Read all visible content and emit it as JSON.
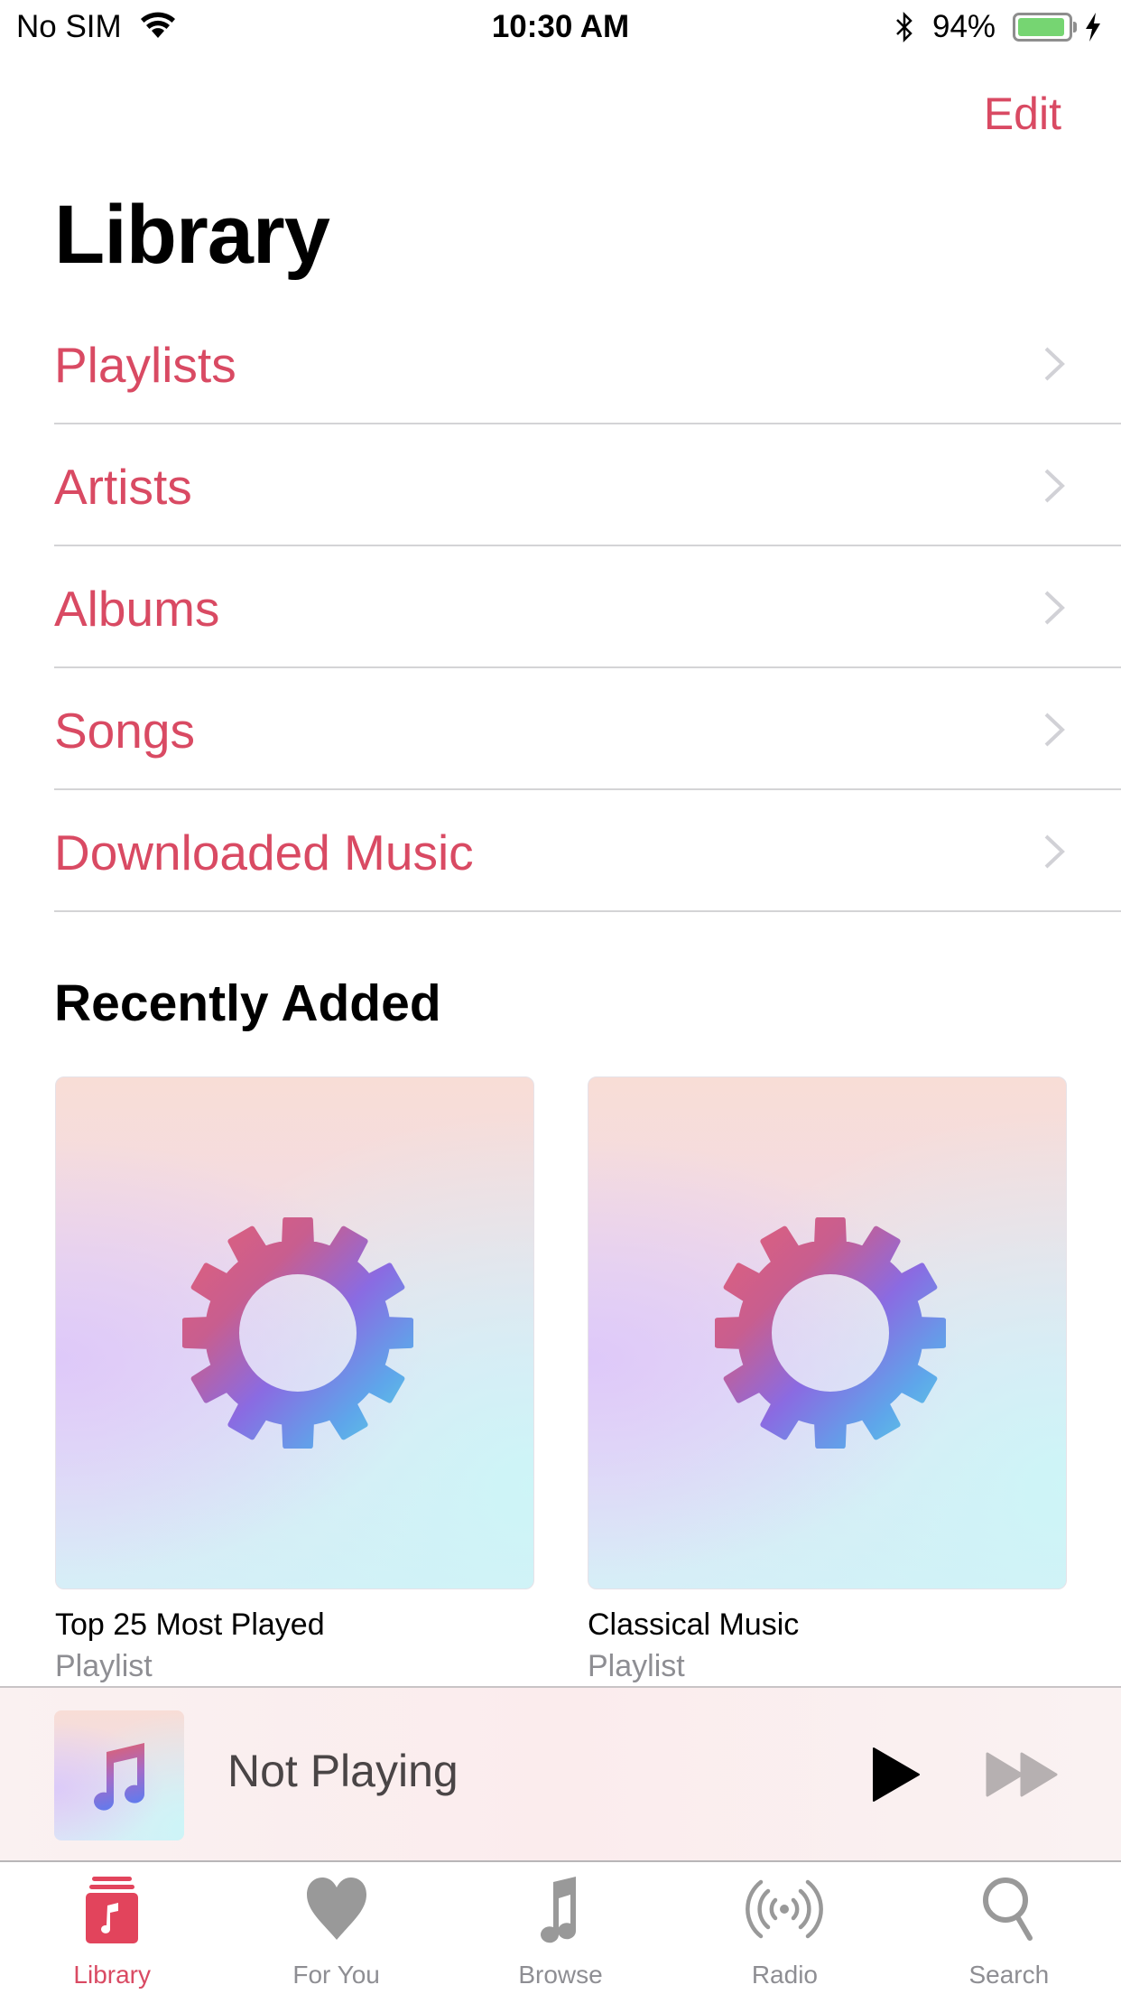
{
  "status_bar": {
    "carrier": "No SIM",
    "wifi_icon": "wifi-icon",
    "time": "10:30 AM",
    "bluetooth_icon": "bluetooth-icon",
    "battery_percent": "94%",
    "battery_level": 0.94,
    "charging_icon": "bolt-icon"
  },
  "nav": {
    "edit_label": "Edit",
    "title": "Library"
  },
  "library_items": [
    {
      "label": "Playlists"
    },
    {
      "label": "Artists"
    },
    {
      "label": "Albums"
    },
    {
      "label": "Songs"
    },
    {
      "label": "Downloaded Music"
    }
  ],
  "recently_added": {
    "title": "Recently Added",
    "items": [
      {
        "title": "Top 25 Most Played",
        "subtitle": "Playlist",
        "artwork_icon": "gear-icon"
      },
      {
        "title": "Classical Music",
        "subtitle": "Playlist",
        "artwork_icon": "gear-icon"
      }
    ]
  },
  "mini_player": {
    "title": "Not Playing",
    "artwork_icon": "music-note-icon",
    "play_icon": "play-icon",
    "forward_icon": "fast-forward-icon"
  },
  "tabs": [
    {
      "label": "Library",
      "icon": "library-icon",
      "active": true
    },
    {
      "label": "For You",
      "icon": "heart-icon",
      "active": false
    },
    {
      "label": "Browse",
      "icon": "music-note-icon",
      "active": false
    },
    {
      "label": "Radio",
      "icon": "radio-icon",
      "active": false
    },
    {
      "label": "Search",
      "icon": "search-icon",
      "active": false
    }
  ],
  "colors": {
    "accent": "#d94a63",
    "chevron": "#c7c7cc",
    "tab_inactive": "#999999",
    "battery_green": "#76d572",
    "secondary_text": "#8e8e93"
  }
}
